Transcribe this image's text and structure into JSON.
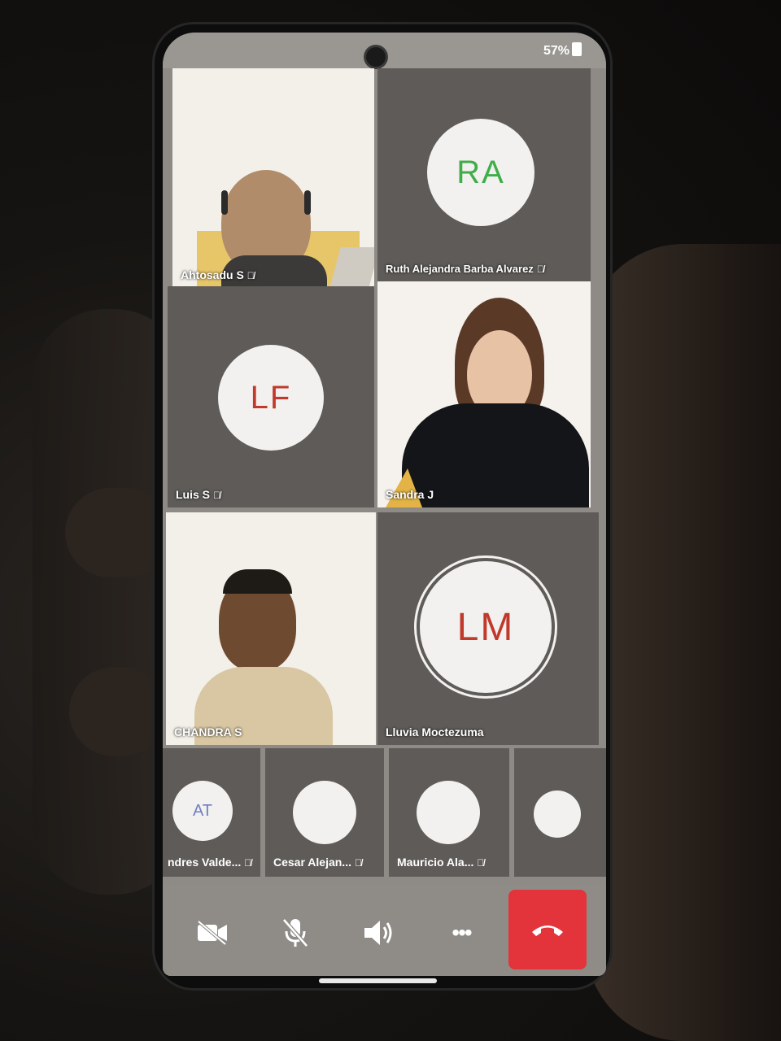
{
  "status": {
    "battery": "57%"
  },
  "tiles": [
    {
      "type": "video",
      "name": "Ahtosadu S"
    },
    {
      "type": "avatar",
      "initials": "RA",
      "initials_color": "#3fae49",
      "name": "Ruth Alejandra Barba Alvarez"
    },
    {
      "type": "avatar",
      "initials": "LF",
      "initials_color": "#c0392b",
      "name": "Luis S"
    },
    {
      "type": "video",
      "name": "Sandra J"
    },
    {
      "type": "video",
      "name": "CHANDRA S"
    },
    {
      "type": "avatar",
      "initials": "LM",
      "initials_color": "#c0392b",
      "name": "Lluvia Moctezuma"
    }
  ],
  "strip": [
    {
      "initials": "AT",
      "name": "ndres Valde..."
    },
    {
      "initials": "",
      "name": "Cesar Alejan..."
    },
    {
      "initials": "",
      "name": "Mauricio Ala..."
    },
    {
      "initials": "",
      "name": ""
    }
  ],
  "toolbar": {
    "camera": "camera-off-icon",
    "mic": "mic-off-icon",
    "speaker": "speaker-icon",
    "more": "•••",
    "end": "end-call-icon"
  },
  "colors": {
    "end_call": "#e3333b",
    "tile_bg": "#5e5b58"
  }
}
